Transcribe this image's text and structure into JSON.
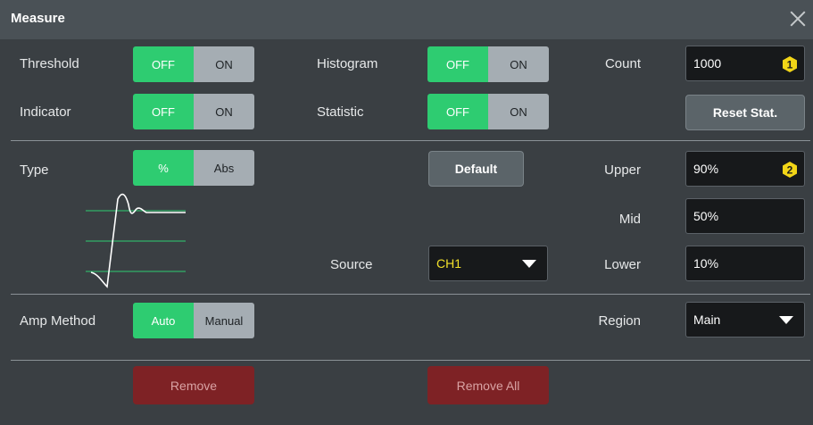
{
  "dialog": {
    "title": "Measure"
  },
  "rows": {
    "threshold": {
      "label": "Threshold",
      "off": "OFF",
      "on": "ON",
      "state": "OFF"
    },
    "indicator": {
      "label": "Indicator",
      "off": "OFF",
      "on": "ON",
      "state": "OFF"
    },
    "histogram": {
      "label": "Histogram",
      "off": "OFF",
      "on": "ON",
      "state": "OFF"
    },
    "statistic": {
      "label": "Statistic",
      "off": "OFF",
      "on": "ON",
      "state": "OFF"
    },
    "count": {
      "label": "Count",
      "value": "1000",
      "badge": "1"
    },
    "reset": {
      "label": "Reset Stat."
    },
    "type": {
      "label": "Type",
      "opt1": "%",
      "opt2": "Abs",
      "state": "%"
    },
    "default": {
      "label": "Default"
    },
    "upper": {
      "label": "Upper",
      "value": "90%",
      "badge": "2"
    },
    "mid": {
      "label": "Mid",
      "value": "50%"
    },
    "lower": {
      "label": "Lower",
      "value": "10%"
    },
    "source": {
      "label": "Source",
      "value": "CH1"
    },
    "amp_method": {
      "label": "Amp Method",
      "opt1": "Auto",
      "opt2": "Manual",
      "state": "Auto"
    },
    "region": {
      "label": "Region",
      "value": "Main"
    },
    "remove": {
      "label": "Remove"
    },
    "remove_all": {
      "label": "Remove All"
    }
  },
  "icons": {
    "close": "close-icon",
    "badge": "hexagon-number-badge-icon",
    "dropdown": "caret-down-icon",
    "waveform": "threshold-waveform-icon"
  },
  "colors": {
    "toggle_active": "#2ecc71",
    "toggle_inactive": "#a5adb3",
    "badge": "#f2d517",
    "remove": "#7e2225",
    "source_text": "#f2e12a"
  }
}
